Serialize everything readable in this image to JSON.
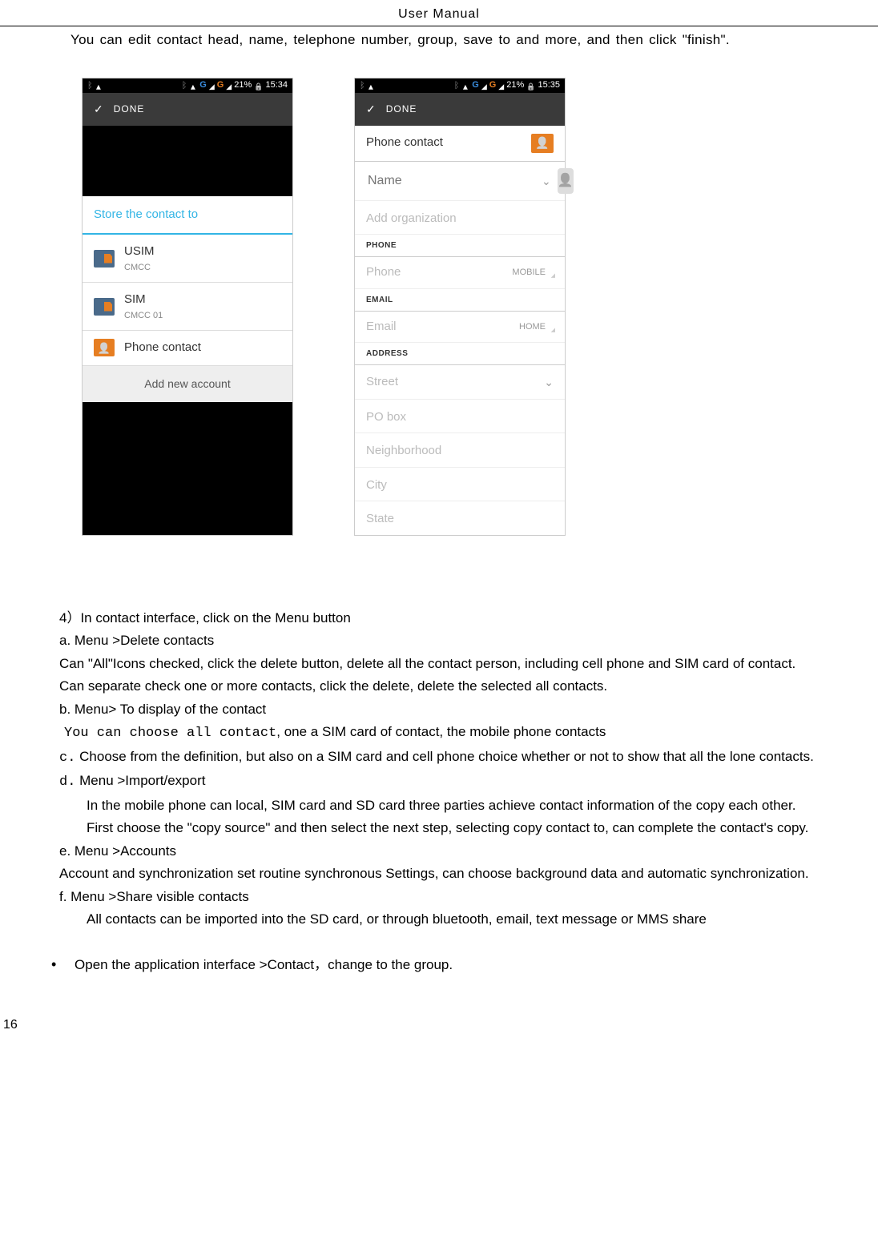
{
  "header": "User    Manual",
  "intro": "You can edit contact head, name, telephone number, group, save to and more, and then click \"finish\".",
  "screenshot1": {
    "status_time": "15:34",
    "battery": "21%",
    "done": "DONE",
    "dialog_title": "Store the contact to",
    "usim": "USIM",
    "usim_sub": "CMCC",
    "sim": "SIM",
    "sim_sub": "CMCC 01",
    "phone_contact": "Phone contact",
    "add_account": "Add new account"
  },
  "screenshot2": {
    "status_time": "15:35",
    "battery": "21%",
    "done": "DONE",
    "phone_contact": "Phone contact",
    "name": "Name",
    "add_org": "Add organization",
    "phone_label": "PHONE",
    "phone": "Phone",
    "mobile": "MOBILE",
    "email_label": "EMAIL",
    "email": "Email",
    "home": "HOME",
    "address_label": "ADDRESS",
    "street": "Street",
    "pobox": "PO box",
    "neighborhood": "Neighborhood",
    "city": "City",
    "state": "State"
  },
  "body": {
    "p4": "4）In contact   interface, click on the Menu button",
    "a_label": "a.    Menu >Delete contacts",
    "a_text1": "Can \"All\"Icons checked, click the delete button, delete all the contact person, including cell phone and SIM card of contact.",
    "a_text2": "Can separate check one or more contacts, click the delete, delete the selected all contacts.",
    "b_label": "b.    Menu>",
    "b_rest": " To display of the contact",
    "b_text1a": "You can choose all contact",
    "b_text1b": ", one a SIM card of contact, the mobile phone contacts",
    "c_label": "c.",
    "c_text": "Choose from the definition, but also on a SIM card and cell phone choice whether or not to show that all the lone contacts.",
    "d_label": "d.",
    "d_menu": "    Menu >Import/export",
    "d_text1": "In the mobile phone can local, SIM card and SD card three parties achieve contact information of the copy each other.",
    "d_text2": "First choose the \"copy source\" and then select the next step, selecting copy contact to, can complete the contact's copy.",
    "e_label": "e.    Menu >Accounts",
    "e_text": "Account and synchronization set routine synchronous Settings, can choose background data and automatic synchronization.",
    "f_label": "f.     Menu >Share visible contacts",
    "f_text": "All contacts can be imported into the SD card, or through bluetooth, email, text message or MMS share",
    "bullet": "Open the   application interface    >Contact，change to the group."
  },
  "page_num": "16"
}
